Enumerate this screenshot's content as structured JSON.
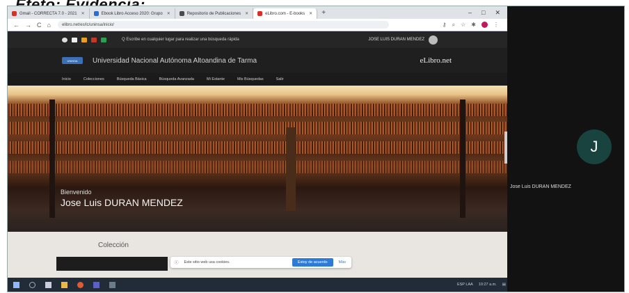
{
  "heading": "Efeto: Evidencia:",
  "browser": {
    "tabs": [
      {
        "label": "Gmail - CORRECTA 7.0 - 2021",
        "color": "#d93025",
        "active": false
      },
      {
        "label": "Ebook Libro Acceso 2020: Grupo",
        "color": "#2c6ecb",
        "active": false
      },
      {
        "label": "Repositorio de Publicaciones",
        "color": "#4a4a4a",
        "active": false
      },
      {
        "label": "eLibro.com - E-books",
        "color": "#d93025",
        "active": true
      }
    ],
    "new_tab": "+",
    "window_controls": [
      "–",
      "□",
      "✕"
    ],
    "url": "elibro.net/es/lc/uninsa/inicio/",
    "nav_icons": [
      "←",
      "→",
      "C",
      "⌂"
    ]
  },
  "site": {
    "topbar_search": "Q  Escribe en cualquier lugar para realizar una búsqueda rápida",
    "login_text": "JOSE LUIS DURAN MENDEZ",
    "logo_text": "UNINSA",
    "university": "Universidad Nacional Autónoma Altoandina de Tarma",
    "brand": "eLibro.net",
    "menu": [
      "Inicio",
      "Colecciones",
      "Búsqueda Básica",
      "Búsqueda Avanzada",
      "Mi Estante",
      "Mis Búsquedas",
      "Salir"
    ],
    "greeting": "Bienvenido",
    "user_name": "Jose Luis DURAN MENDEZ",
    "section": "Colección",
    "cookie": {
      "text": "Este sitio web usa cookies.",
      "accept": "Estoy de acuerdo",
      "more": "Más"
    }
  },
  "taskbar": {
    "tray": "ESP  LAA",
    "time": "10:27 a.m."
  },
  "meeting": {
    "avatar_letter": "J",
    "participant": "Jose Luis DURAN MENDEZ"
  },
  "colors": {
    "avatar": "#19433f",
    "accent_blue": "#2e7bd6",
    "topbar": "#262626"
  }
}
